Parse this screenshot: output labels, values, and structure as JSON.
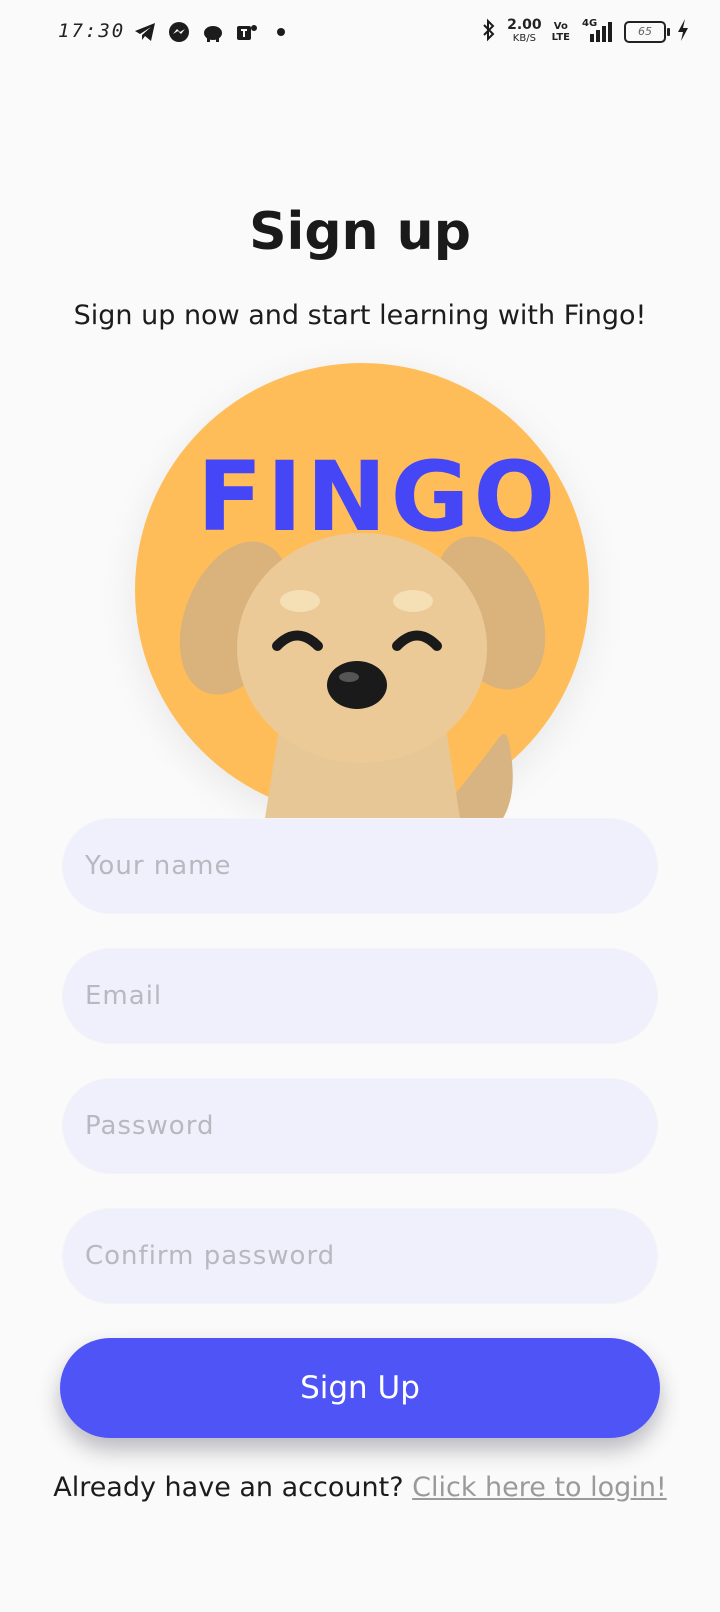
{
  "status_bar": {
    "time": "17:30",
    "net_speed": "2.00",
    "net_unit": "KB/S",
    "volte_top": "Vo",
    "volte_bottom": "LTE",
    "network_type": "4G",
    "battery_level": "65",
    "notification_icons": [
      "telegram-icon",
      "messenger-icon",
      "piggy-bank-icon",
      "teams-icon",
      "dot-icon"
    ],
    "system_icons": [
      "bluetooth-icon",
      "signal-icon",
      "charging-icon"
    ]
  },
  "page": {
    "title": "Sign up",
    "subtitle": "Sign up now and start learning with Fingo!"
  },
  "hero": {
    "logo_text": "FINGO",
    "circle_color": "#ffbd5a",
    "logo_color": "#4546f5"
  },
  "form": {
    "name_placeholder": "Your name",
    "email_placeholder": "Email",
    "password_placeholder": "Password",
    "confirm_placeholder": "Confirm password",
    "submit_label": "Sign Up",
    "submit_color": "#4f54f7"
  },
  "footer": {
    "prompt": "Already have an account?",
    "link_label": "Click here to login!"
  }
}
